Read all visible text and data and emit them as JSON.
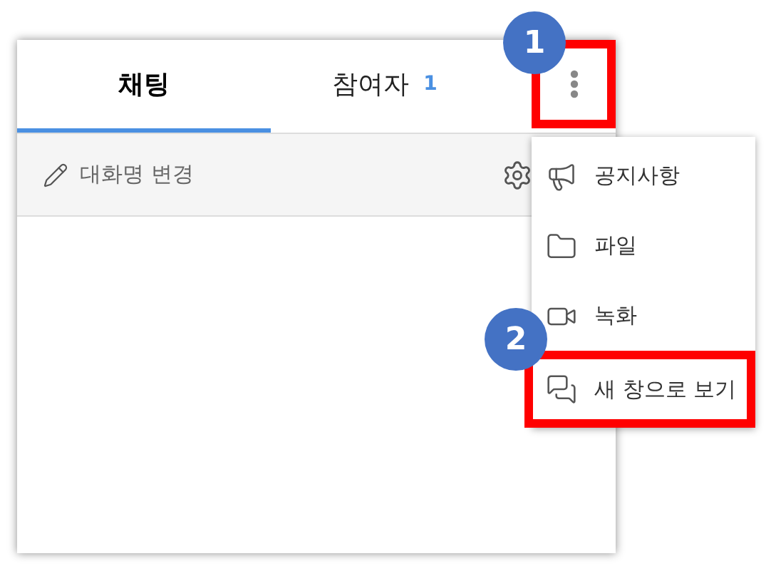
{
  "tabs": [
    {
      "label": "채팅",
      "selected": true
    },
    {
      "label": "참여자",
      "count": "1",
      "selected": false
    }
  ],
  "more_button": {
    "highlighted": true,
    "callout": "1"
  },
  "toolbar": {
    "rename_label": "대화명 변경"
  },
  "menu": {
    "items": [
      {
        "label": "공지사항",
        "kind": "notice",
        "highlighted": false
      },
      {
        "label": "파일",
        "kind": "file",
        "highlighted": false
      },
      {
        "label": "녹화",
        "kind": "record",
        "highlighted": false
      },
      {
        "label": "새 창으로 보기",
        "kind": "new_window",
        "highlighted": true,
        "callout": "2"
      }
    ]
  }
}
